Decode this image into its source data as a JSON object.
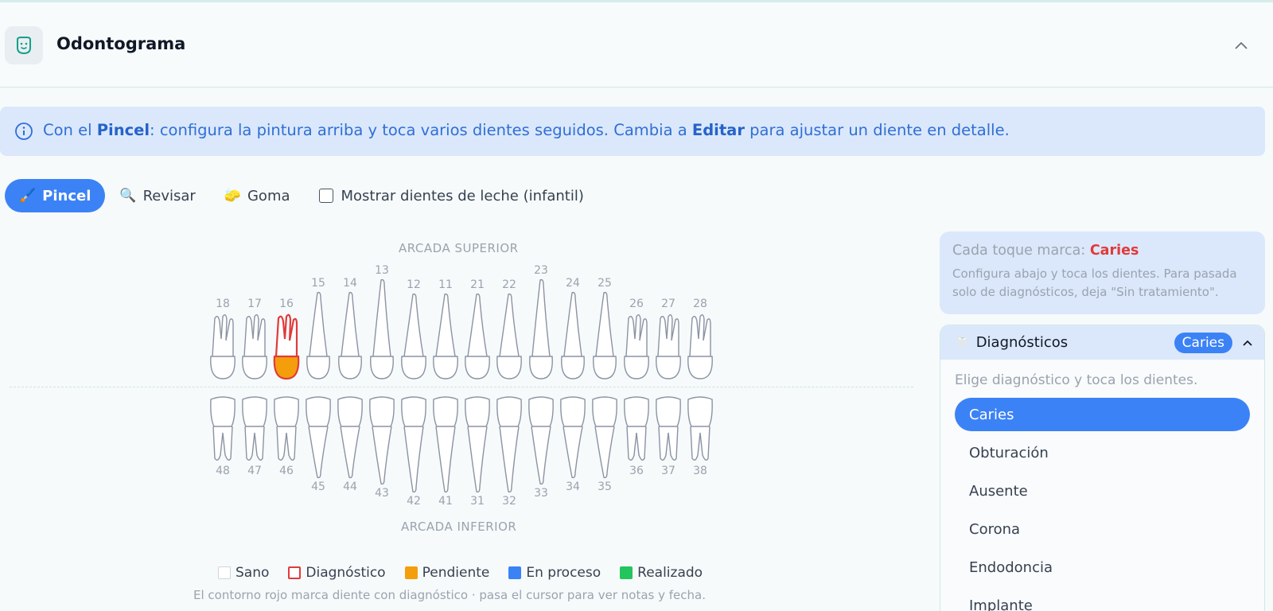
{
  "header": {
    "title": "Odontograma",
    "logo_icon": "tooth-face-icon",
    "collapse_icon": "chevron-up-icon"
  },
  "info_banner": {
    "icon": "info-icon",
    "prefix": "Con el ",
    "bold1": "Pincel",
    "middle": ": configura la pintura arriba y toca varios dientes seguidos. Cambia a ",
    "bold2": "Editar",
    "suffix": " para ajustar un diente en detalle."
  },
  "modes": [
    {
      "glyph": "🖌️",
      "label": "Pincel",
      "active": true,
      "icon": "paintbrush-icon"
    },
    {
      "glyph": "🔍",
      "label": "Revisar",
      "active": false,
      "icon": "magnifier-icon"
    },
    {
      "glyph": "🧽",
      "label": "Goma",
      "active": false,
      "icon": "sponge-icon"
    }
  ],
  "milk_teeth_checkbox": {
    "label": "Mostrar dientes de leche (infantil)",
    "checked": false
  },
  "odontogram": {
    "upper_label": "ARCADA SUPERIOR",
    "lower_label": "ARCADA INFERIOR",
    "upper_teeth": [
      "18",
      "17",
      "16",
      "15",
      "14",
      "13",
      "12",
      "11",
      "21",
      "22",
      "23",
      "24",
      "25",
      "26",
      "27",
      "28"
    ],
    "lower_teeth": [
      "48",
      "47",
      "46",
      "45",
      "44",
      "43",
      "42",
      "41",
      "31",
      "32",
      "33",
      "34",
      "35",
      "36",
      "37",
      "38"
    ],
    "marked_teeth": [
      {
        "tooth": "16",
        "status": "Diagnóstico",
        "fill": "Pendiente"
      }
    ]
  },
  "legend": [
    {
      "label": "Sano",
      "color": "#ffffff",
      "border": "#d1d5db"
    },
    {
      "label": "Diagnóstico",
      "color": "#ffffff",
      "border": "#e03b3b"
    },
    {
      "label": "Pendiente",
      "color": "#f59e0b",
      "border": "#f59e0b"
    },
    {
      "label": "En proceso",
      "color": "#3b82f6",
      "border": "#3b82f6"
    },
    {
      "label": "Realizado",
      "color": "#22c55e",
      "border": "#22c55e"
    }
  ],
  "footnote": "El contorno rojo marca diente con diagnóstico · pasa el cursor para ver notas y fecha.",
  "side_panel": {
    "hint_prefix": "Cada toque marca: ",
    "hint_value": "Caries",
    "hint_detail": "Configura abajo y toca los dientes. Para pasada solo de diagnósticos, deja \"Sin tratamiento\".",
    "diagnostics": {
      "title": "Diagnósticos",
      "badge": "Caries",
      "subtitle": "Elige diagnóstico y toca los dientes.",
      "items": [
        "Caries",
        "Obturación",
        "Ausente",
        "Corona",
        "Endodoncia",
        "Implante"
      ],
      "selected": "Caries"
    }
  },
  "colors": {
    "accent": "#3b82f6",
    "diagnosis": "#e03b3b",
    "pending": "#f59e0b"
  }
}
